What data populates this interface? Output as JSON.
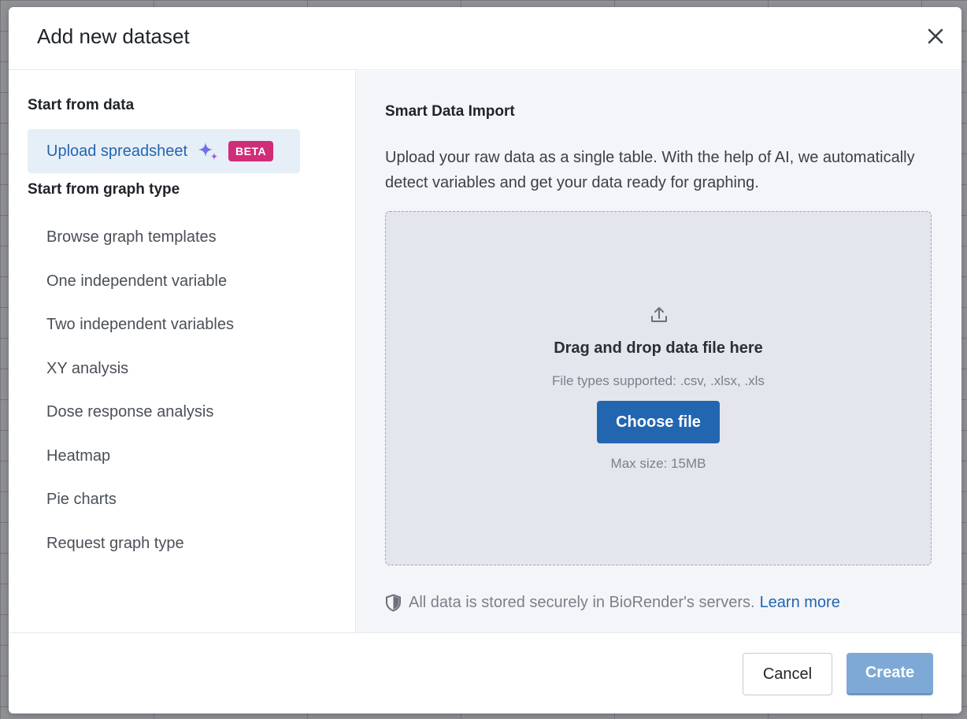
{
  "dialog": {
    "title": "Add new dataset"
  },
  "sidebar": {
    "data_heading": "Start from data",
    "upload_item": {
      "label": "Upload spreadsheet",
      "icon": "sparkle-icon",
      "badge": "BETA"
    },
    "graph_heading": "Start from graph type",
    "items": [
      {
        "label": "Browse graph templates"
      },
      {
        "label": "One independent variable"
      },
      {
        "label": "Two independent variables"
      },
      {
        "label": "XY analysis"
      },
      {
        "label": "Dose response analysis"
      },
      {
        "label": "Heatmap"
      },
      {
        "label": "Pie charts"
      },
      {
        "label": "Request graph type"
      }
    ]
  },
  "main": {
    "title": "Smart Data Import",
    "description": "Upload your raw data as a single table. With the help of AI, we automatically detect variables and get your data ready for graphing.",
    "dropzone": {
      "title": "Drag and drop data file here",
      "file_types": "File types supported: .csv, .xlsx, .xls",
      "button_label": "Choose file",
      "max_size": "Max size: 15MB"
    },
    "security": {
      "text": "All data is stored securely in BioRender's servers.",
      "link": "Learn more"
    }
  },
  "footer": {
    "cancel_label": "Cancel",
    "create_label": "Create"
  },
  "colors": {
    "accent": "#2366b0",
    "beta_badge": "#d02d79",
    "create_disabled": "#7ea9d6"
  }
}
